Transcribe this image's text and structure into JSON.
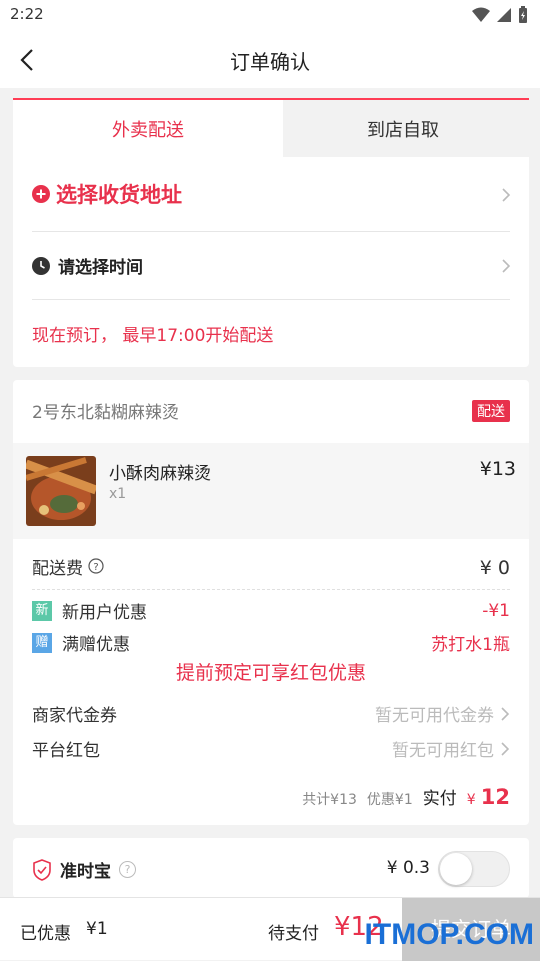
{
  "status_bar": {
    "time": "2:22"
  },
  "nav": {
    "title": "订单确认"
  },
  "tabs": {
    "delivery": "外卖配送",
    "pickup": "到店自取"
  },
  "address": {
    "select_label": "选择收货地址",
    "time_label": "请选择时间",
    "notice": "现在预订， 最早17:00开始配送"
  },
  "shop": {
    "name": "2号东北黏糊麻辣烫",
    "badge": "配送",
    "item": {
      "name": "小酥肉麻辣烫",
      "qty": "x1",
      "price": "¥13"
    },
    "delivery_fee_label": "配送费",
    "delivery_fee": "¥ 0",
    "new_user": {
      "icon": "新",
      "label": "新用户优惠",
      "value": "-¥1"
    },
    "gift": {
      "icon": "赠",
      "label": "满赠优惠",
      "value": "苏打水1瓶"
    },
    "promo_banner": "提前预定可享红包优惠",
    "merchant_voucher": {
      "label": "商家代金券",
      "value": "暂无可用代金券"
    },
    "platform_redpack": {
      "label": "平台红包",
      "value": "暂无可用红包"
    },
    "summary": {
      "total": "共计¥13",
      "discount": "优惠¥1",
      "paid_label": "实付",
      "currency": "¥",
      "paid": "12"
    }
  },
  "insurance": {
    "label": "准时宝",
    "help": "?",
    "price": "¥ 0.3"
  },
  "bottom": {
    "discount_label": "已优惠",
    "discount_value": "¥1",
    "pending_label": "待支付",
    "pending_value": "¥12",
    "submit": "提交订单"
  },
  "watermark": "ITMOP.COM",
  "colors": {
    "accent": "#e8314c",
    "new_badge": "#5cc8a8",
    "gift_badge": "#5aa6e6",
    "watermark": "#1a6fd6"
  }
}
